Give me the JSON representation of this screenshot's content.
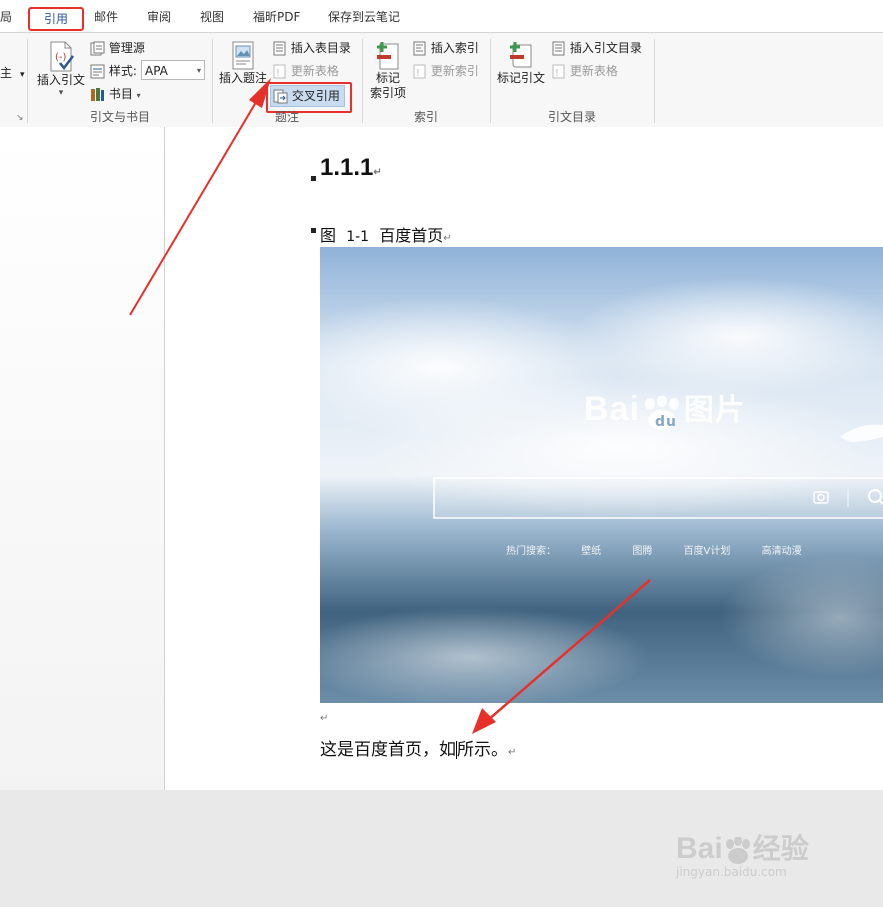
{
  "tabs": {
    "items": [
      "局",
      "引用",
      "邮件",
      "审阅",
      "视图",
      "福昕PDF",
      "保存到云笔记"
    ]
  },
  "ribbon": {
    "group1": {
      "insert_citation": "插入引文",
      "manage_sources": "管理源",
      "style_label": "样式:",
      "style_value": "APA",
      "bibliography": "书目",
      "label": "引文与书目"
    },
    "group2": {
      "insert_caption": "插入题注",
      "insert_table_of_figures": "插入表目录",
      "update_table": "更新表格",
      "cross_reference": "交叉引用",
      "label": "题注"
    },
    "group3": {
      "mark_entry": "标记\n索引项",
      "insert_index": "插入索引",
      "update_index": "更新索引",
      "label": "索引"
    },
    "group4": {
      "mark_citation": "标记引文",
      "insert_table_of_authorities": "插入引文目录",
      "update_table": "更新表格",
      "label": "引文目录"
    },
    "left_partial": "主"
  },
  "document": {
    "heading": "1.1.1",
    "caption_prefix": "图",
    "caption_number": "1-1",
    "caption_text": "百度首页",
    "body_text_before": "这是百度首页，如",
    "body_text_after": "所示。",
    "para_mark": "↵"
  },
  "image": {
    "logo_text": "Bai",
    "logo_text2": "图片",
    "hot_search_label": "热门搜索：",
    "hot_links": [
      "壁纸",
      "图腾",
      "百度V计划",
      "高清动漫"
    ]
  },
  "watermark": {
    "brand": "Bai",
    "brand2": "经验",
    "url": "jingyan.baidu.com"
  },
  "colors": {
    "highlight_red": "#e8302a",
    "accent_blue": "#2b579a"
  }
}
